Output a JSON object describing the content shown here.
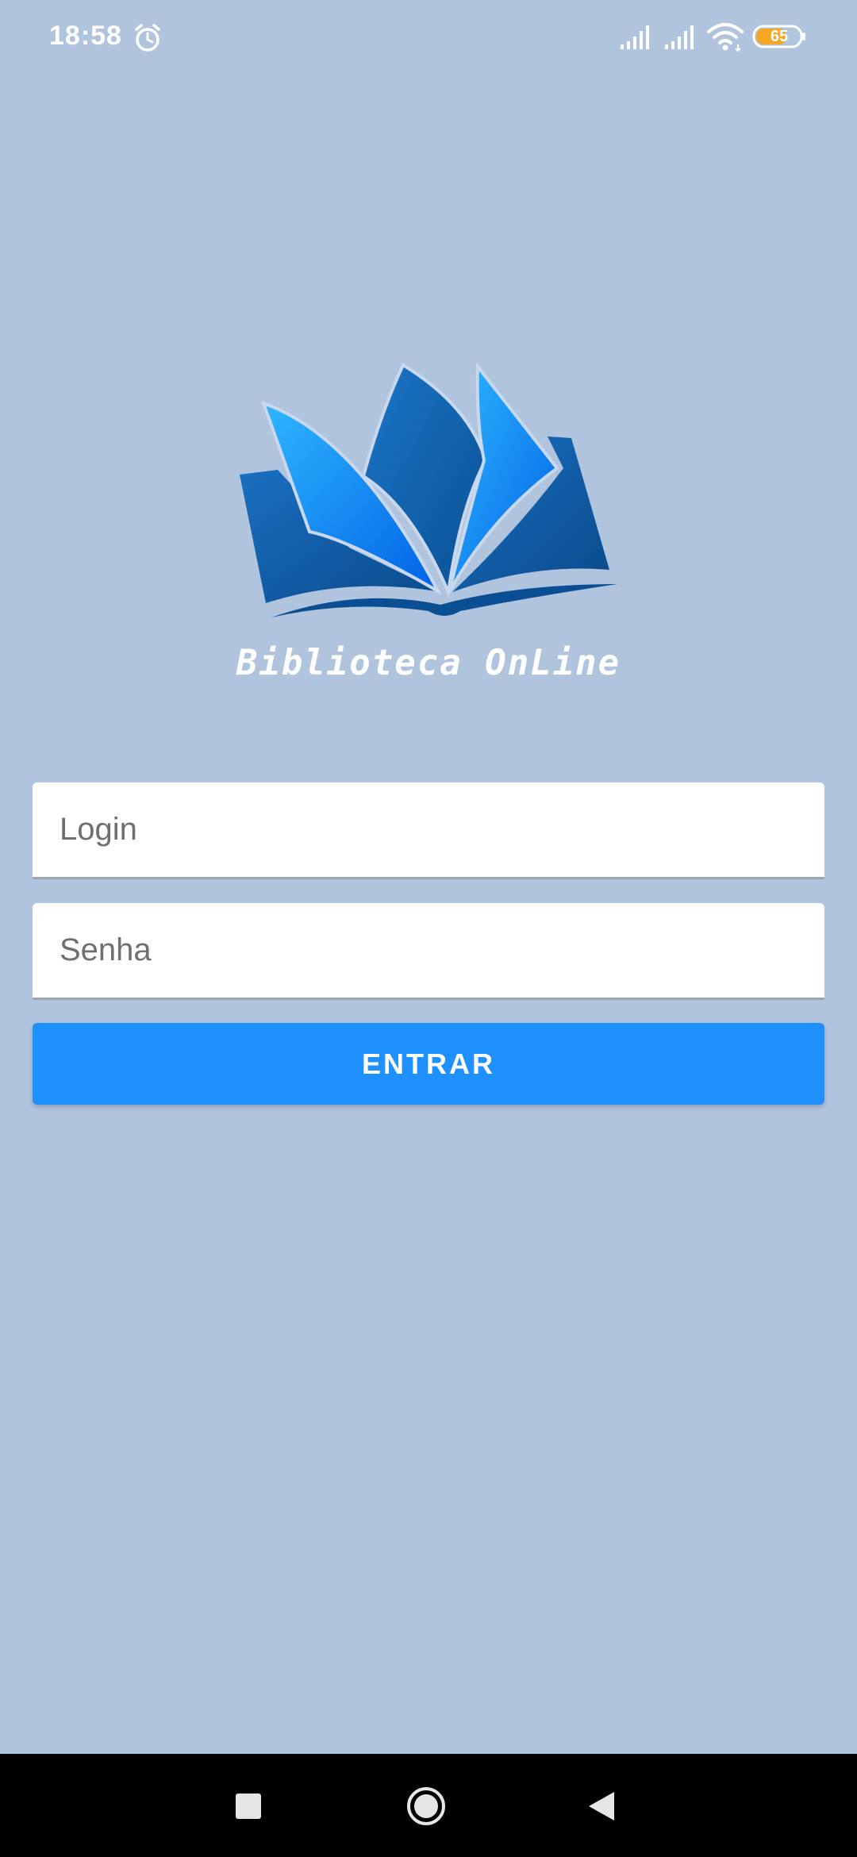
{
  "status_bar": {
    "time": "18:58",
    "battery_level": "65",
    "icons": [
      "alarm-icon",
      "cellular-signal-icon",
      "cellular-signal-icon",
      "wifi-icon",
      "battery-icon"
    ]
  },
  "logo": {
    "app_name": "Biblioteca OnLine",
    "icon": "open-book-icon"
  },
  "form": {
    "login_placeholder": "Login",
    "login_value": "",
    "password_placeholder": "Senha",
    "password_value": "",
    "submit_label": "ENTRAR"
  },
  "navigation": {
    "icons": [
      "recents-icon",
      "home-icon",
      "back-icon"
    ]
  },
  "colors": {
    "background": "#b0c4de",
    "button": "#1e90ff",
    "book_dark": "#0b5ea8",
    "book_light": "#00a8ff",
    "battery_fill": "#f5a623"
  }
}
